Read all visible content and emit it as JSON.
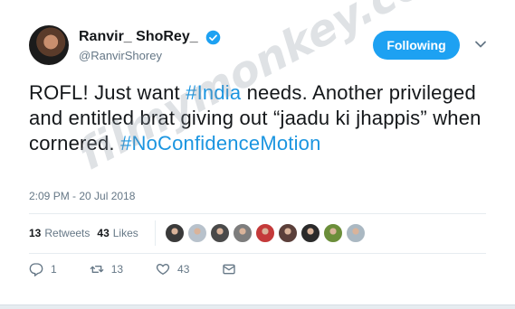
{
  "user": {
    "display_name": "Ranvir_ ShoRey_",
    "handle": "@RanvirShorey"
  },
  "follow_button": {
    "label": "Following"
  },
  "tweet": {
    "segments": [
      {
        "text": "ROFL! Just want ",
        "hashtag": false
      },
      {
        "text": "#India",
        "hashtag": true
      },
      {
        "text": " needs. Another privileged and entitled brat giving out “jaadu ki jhappis” when cornered. ",
        "hashtag": false
      },
      {
        "text": "#NoConfidenceMotion",
        "hashtag": true
      }
    ],
    "timestamp": "2:09 PM - 20 Jul 2018"
  },
  "stats": {
    "retweets_count": "13",
    "retweets_label": "Retweets",
    "likes_count": "43",
    "likes_label": "Likes"
  },
  "liker_avatars": [
    "#3a3a3a",
    "#b8c2cc",
    "#4a4a4a",
    "#7d7d7d",
    "#c43a3a",
    "#5b3f3a",
    "#2a2a2a",
    "#6b8e3a",
    "#aab8c2"
  ],
  "actions": {
    "reply_count": "1",
    "retweet_count": "13",
    "like_count": "43"
  },
  "icons": {
    "verified": "verified-badge-icon",
    "chevron": "chevron-down-icon",
    "reply": "reply-icon",
    "retweet": "retweet-icon",
    "like": "heart-icon",
    "dm": "envelope-icon"
  },
  "colors": {
    "accent": "#1da1f2",
    "hashtag": "#1b95e0",
    "muted": "#657786",
    "text": "#14171a"
  },
  "watermark": {
    "text": "filmymonkey.com"
  }
}
